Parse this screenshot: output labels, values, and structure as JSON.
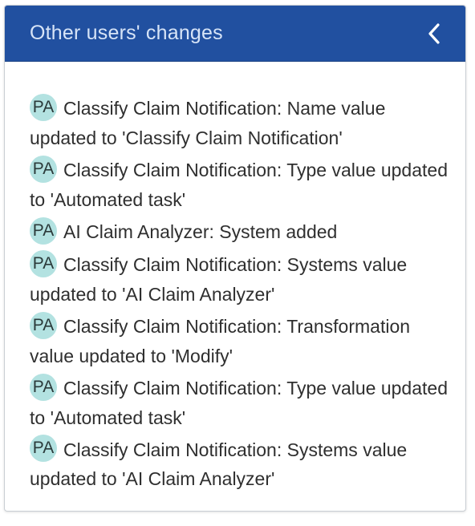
{
  "panel": {
    "title": "Other users' changes",
    "accent_color": "#2150a0",
    "collapse_icon": "chevron-left-icon"
  },
  "changes": [
    {
      "initials": "PA",
      "text": "Classify Claim Notification: Name value updated to 'Classify Claim Notification'"
    },
    {
      "initials": "PA",
      "text": "Classify Claim Notification: Type value updated to 'Automated task'"
    },
    {
      "initials": "PA",
      "text": "AI Claim Analyzer: System added"
    },
    {
      "initials": "PA",
      "text": "Classify Claim Notification: Systems value updated to 'AI Claim Analyzer'"
    },
    {
      "initials": "PA",
      "text": "Classify Claim Notification: Transformation value updated to 'Modify'"
    },
    {
      "initials": "PA",
      "text": "Classify Claim Notification: Type value updated to 'Automated task'"
    },
    {
      "initials": "PA",
      "text": "Classify Claim Notification: Systems value updated to 'AI Claim Analyzer'"
    }
  ]
}
